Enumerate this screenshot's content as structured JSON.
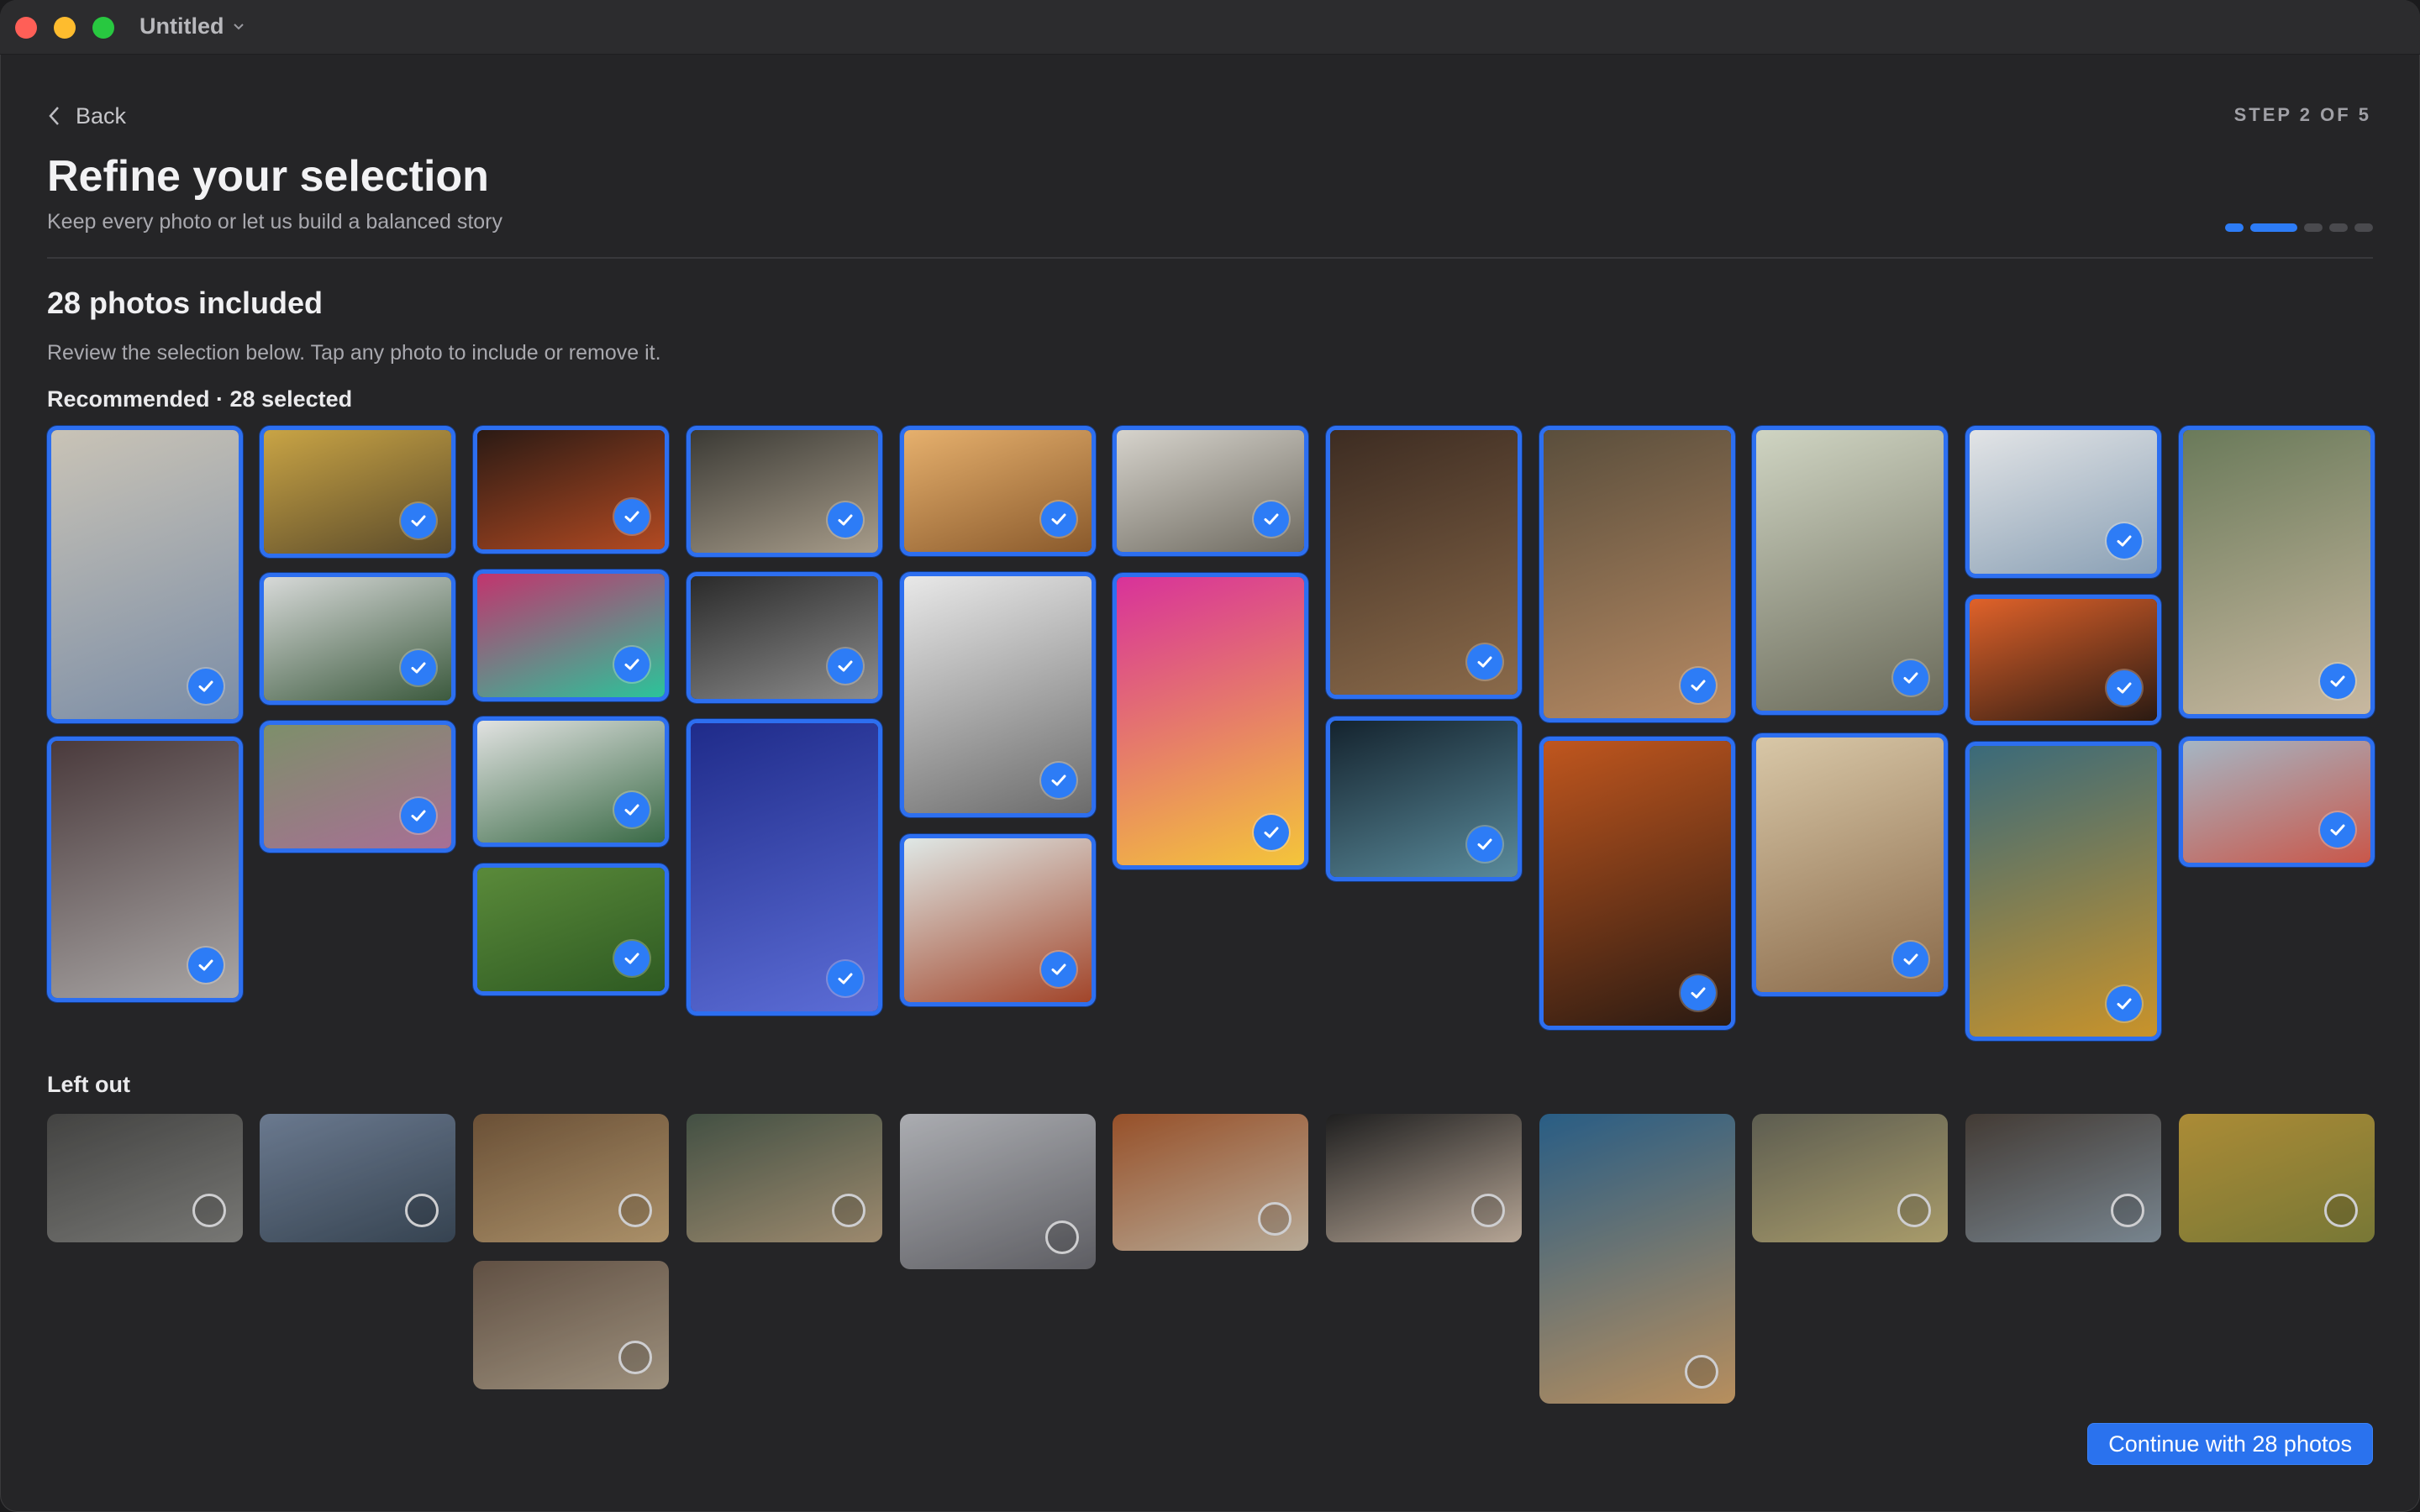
{
  "window": {
    "title": "Untitled"
  },
  "header": {
    "back_label": "Back",
    "step_label": "STEP 2 OF 5",
    "title": "Refine your selection",
    "subtitle": "Keep every photo or let us build a balanced story",
    "progress": {
      "current_step": 2,
      "total_steps": 5
    }
  },
  "summary": {
    "count_title": "28 photos included",
    "description": "Review the selection below. Tap any photo to include or remove it."
  },
  "recommended": {
    "label": "Recommended · 28 selected",
    "photos": [
      {
        "id": "beach-shack",
        "colors": [
          "#c9c3b6",
          "#7b8da6"
        ]
      },
      {
        "id": "film-reel",
        "colors": [
          "#4a3a3c",
          "#a9a6a5"
        ]
      },
      {
        "id": "golden-grass",
        "colors": [
          "#c9a445",
          "#5a4a2a"
        ]
      },
      {
        "id": "film-strip",
        "colors": [
          "#d7d9d8",
          "#3c5a3e"
        ]
      },
      {
        "id": "coast-flowers",
        "colors": [
          "#7d8f6a",
          "#a86f95"
        ]
      },
      {
        "id": "night-bar",
        "colors": [
          "#2b1a14",
          "#b24a22"
        ]
      },
      {
        "id": "gradient-blur",
        "colors": [
          "#c2346e",
          "#2bc49a"
        ]
      },
      {
        "id": "film-strip-2",
        "colors": [
          "#e1e2e1",
          "#3a6a46"
        ]
      },
      {
        "id": "child-garden",
        "colors": [
          "#5a8a3a",
          "#2e5a22"
        ]
      },
      {
        "id": "cafe-street",
        "colors": [
          "#3b3a35",
          "#a79c8a"
        ]
      },
      {
        "id": "studio-lights",
        "colors": [
          "#2a2a2a",
          "#8c8c8c"
        ]
      },
      {
        "id": "arcade",
        "colors": [
          "#1f2b8a",
          "#5c6dd6"
        ]
      },
      {
        "id": "hair-smile",
        "colors": [
          "#e6b06d",
          "#8a5a2c"
        ]
      },
      {
        "id": "newspaper",
        "colors": [
          "#e8e8e8",
          "#6c6c6c"
        ]
      },
      {
        "id": "film-negative",
        "colors": [
          "#dfe8e6",
          "#a2452a"
        ]
      },
      {
        "id": "beach-people",
        "colors": [
          "#d6d3cc",
          "#6e6a60"
        ]
      },
      {
        "id": "vinyl-records",
        "colors": [
          "#d8329a",
          "#f4c53a"
        ]
      },
      {
        "id": "poster-room",
        "colors": [
          "#3d2c22",
          "#8a6a4a"
        ]
      },
      {
        "id": "smoke-dark",
        "colors": [
          "#14232e",
          "#5a8a9a"
        ]
      },
      {
        "id": "retro-tv",
        "colors": [
          "#5a4e3c",
          "#b78a63"
        ]
      },
      {
        "id": "orange-film",
        "colors": [
          "#c0561e",
          "#2a1a12"
        ]
      },
      {
        "id": "pastel-phone",
        "colors": [
          "#cfd4c2",
          "#6a6a5a"
        ]
      },
      {
        "id": "kid-kitchen",
        "colors": [
          "#d8c7a7",
          "#8a6a4a"
        ]
      },
      {
        "id": "diner",
        "colors": [
          "#e2e4e6",
          "#8aa0b5"
        ]
      },
      {
        "id": "orange-roll",
        "colors": [
          "#e0622a",
          "#2a1a12"
        ]
      },
      {
        "id": "light-leak",
        "colors": [
          "#3a6a7a",
          "#c9932a"
        ]
      },
      {
        "id": "crowd",
        "colors": [
          "#6a7a5a",
          "#c8b8a0"
        ]
      },
      {
        "id": "picnic",
        "colors": [
          "#a5b6c4",
          "#c9574a"
        ]
      }
    ]
  },
  "left_out": {
    "label": "Left out",
    "photos": [
      {
        "id": "kids-field",
        "colors": [
          "#4a4a48",
          "#8a8a86"
        ]
      },
      {
        "id": "swing",
        "colors": [
          "#7a8ca6",
          "#3a4a5a"
        ]
      },
      {
        "id": "archive-cards",
        "colors": [
          "#7a5a3a",
          "#c8a878"
        ]
      },
      {
        "id": "desert-road",
        "colors": [
          "#6e5a4a",
          "#b8a890"
        ]
      },
      {
        "id": "mountain-drive",
        "colors": [
          "#4a5a4a",
          "#b7a07e"
        ]
      },
      {
        "id": "polaroid-sleep",
        "colors": [
          "#c9cbd0",
          "#6a6a70"
        ]
      },
      {
        "id": "canyon-van",
        "colors": [
          "#b05a2a",
          "#d8c8b0"
        ]
      },
      {
        "id": "girl-camera",
        "colors": [
          "#1e1e1e",
          "#d6c2ae"
        ]
      },
      {
        "id": "toy-blocks",
        "colors": [
          "#2a6a9a",
          "#d8a66a"
        ]
      },
      {
        "id": "tree-road",
        "colors": [
          "#6a6a5a",
          "#c6b67a"
        ]
      },
      {
        "id": "boy-mirror",
        "colors": [
          "#4a4038",
          "#8a9aa6"
        ]
      },
      {
        "id": "sunny-boy",
        "colors": [
          "#c9a23a",
          "#8a8a3a"
        ]
      }
    ]
  },
  "footer": {
    "continue_label": "Continue with 28 photos"
  },
  "colors": {
    "accent": "#2d7cf6",
    "background": "#252527"
  }
}
